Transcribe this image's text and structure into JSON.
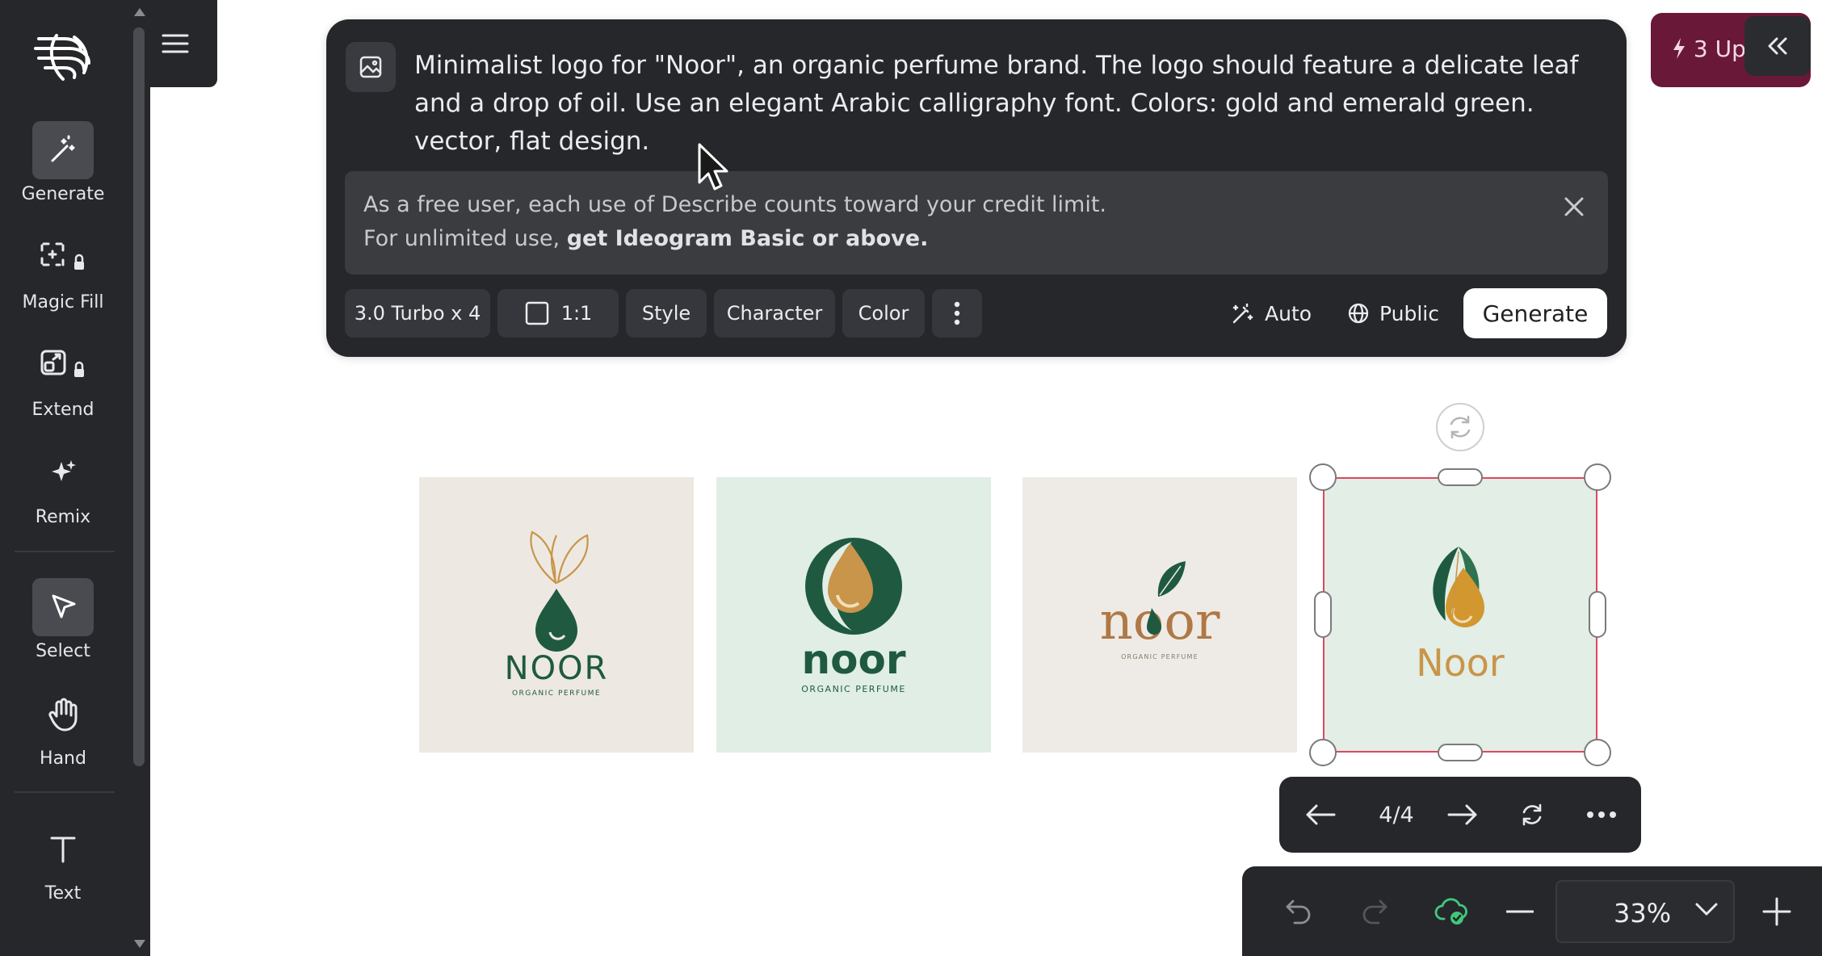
{
  "sidebar": {
    "tools": [
      {
        "label": "Generate"
      },
      {
        "label": "Magic Fill"
      },
      {
        "label": "Extend"
      },
      {
        "label": "Remix"
      },
      {
        "label": "Select"
      },
      {
        "label": "Hand"
      },
      {
        "label": "Text"
      }
    ]
  },
  "prompt": {
    "text": "Minimalist logo for \"Noor\", an organic perfume brand. The logo should feature a delicate leaf and a drop of oil. Use an elegant Arabic calligraphy font. Colors: gold and emerald green. vector, flat design."
  },
  "notice": {
    "line1": "As a free user, each use of Describe counts toward your credit limit.",
    "line2_prefix": "For unlimited use, ",
    "line2_link": "get Ideogram Basic or above."
  },
  "options": {
    "model": "3.0 Turbo x 4",
    "aspect": "1:1",
    "style": "Style",
    "character": "Character",
    "color": "Color",
    "auto": "Auto",
    "visibility": "Public",
    "generate": "Generate"
  },
  "upgrade": {
    "label": "3 Upgrade"
  },
  "images": [
    {
      "brand": "NOOR",
      "tagline": "ORGANIC PERFUME",
      "bg": "#ede9e2"
    },
    {
      "brand": "noor",
      "tagline": "ORGANIC PERFUME",
      "bg": "#e0eee5"
    },
    {
      "brand": "noor",
      "tagline": "ORGANIC PERFUME",
      "bg": "#eeebe6"
    },
    {
      "brand": "Noor",
      "tagline": "",
      "bg": "#e2eee6"
    }
  ],
  "pager": {
    "counter": "4/4"
  },
  "zoom": {
    "value": "33%"
  },
  "colors": {
    "panel": "#26272b",
    "accent_selection": "#e0465e",
    "emerald": "#1f5a40",
    "gold": "#c9954a",
    "upgrade": "#6a1838",
    "cloud_ok": "#3fc97d"
  },
  "icons": [
    "logo-icon",
    "generate-icon",
    "magic-fill-icon",
    "lock-icon",
    "extend-icon",
    "remix-icon",
    "select-icon",
    "hand-icon",
    "text-icon",
    "menu-icon",
    "image-upload-icon",
    "close-icon",
    "aspect-square-icon",
    "more-vertical-icon",
    "magic-wand-icon",
    "globe-icon",
    "bolt-icon",
    "chevron-double-left-icon",
    "rotate-icon",
    "arrow-left-icon",
    "arrow-right-icon",
    "refresh-icon",
    "more-horizontal-icon",
    "undo-icon",
    "redo-icon",
    "cloud-check-icon",
    "minus-icon",
    "chevron-down-icon",
    "plus-icon"
  ]
}
